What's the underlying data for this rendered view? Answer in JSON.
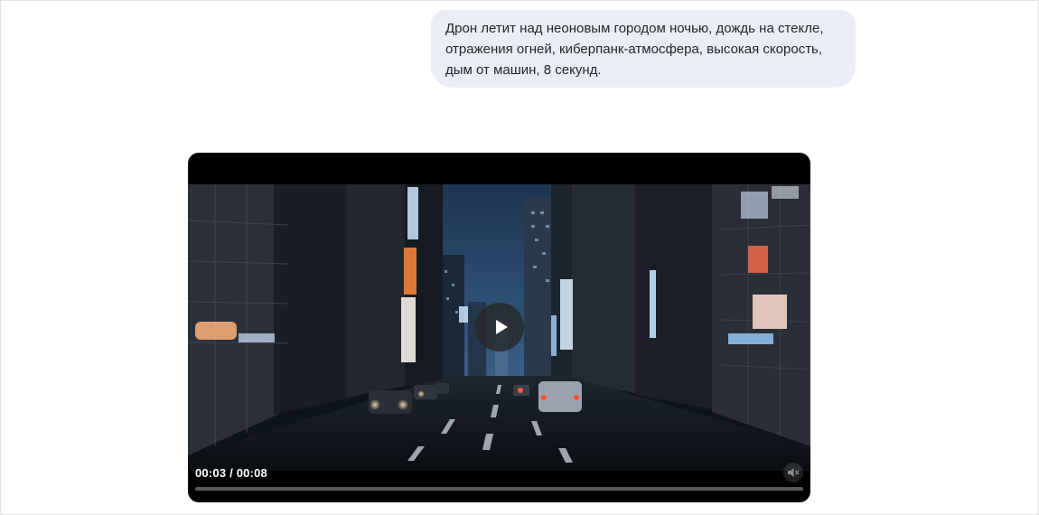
{
  "chat": {
    "user_message": "Дрон летит над неоновым городом ночью, дождь на стекле, отражения огней, киберпанк-атмосфера, высокая скорость, дым от машин, 8 секунд."
  },
  "video_player": {
    "current_time": "00:03",
    "separator": "/",
    "duration": "00:08",
    "progress": 0,
    "icons": {
      "play": "play-icon",
      "mute": "speaker-muted-icon"
    }
  }
}
